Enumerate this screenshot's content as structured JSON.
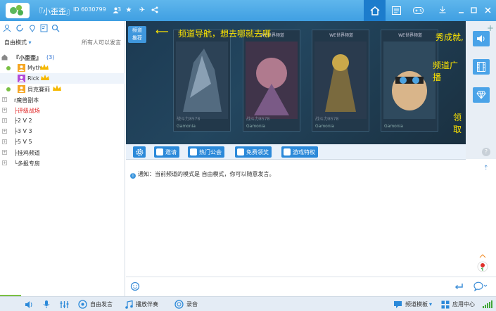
{
  "titlebar": {
    "channel_name": "『小歪歪』",
    "channel_id": "ID 6030799",
    "member_count": "3",
    "accent": "#1c7ccc"
  },
  "left": {
    "mode": "自由模式",
    "mode_note": "所有人可以发言",
    "tree": [
      {
        "label": "『小歪歪』",
        "count": "(3)",
        "type": "root"
      },
      {
        "label": "Myth",
        "type": "user"
      },
      {
        "label": "Rick",
        "type": "user"
      },
      {
        "label": "貝克賽莉",
        "type": "user"
      },
      {
        "label": "r魔兽副本",
        "type": "channel"
      },
      {
        "label": "├评级战场",
        "type": "channel",
        "red": true
      },
      {
        "label": "├2 V 2",
        "type": "channel"
      },
      {
        "label": "├3 V 3",
        "type": "channel"
      },
      {
        "label": "├5 V 5",
        "type": "channel"
      },
      {
        "label": "├挂鸡频道",
        "type": "channel"
      },
      {
        "label": "└多报专房",
        "type": "channel"
      }
    ]
  },
  "banner": {
    "tip_badge_line1": "频道",
    "tip_badge_line2": "推荐",
    "tip_text": "频道导航，想去哪就去哪",
    "right_text1": "秀成就,",
    "right_text2": "频道广播",
    "right_text3": "领取",
    "card_captions": [
      "战斗力8578",
      "战斗力8578",
      "战斗力8578"
    ],
    "card_names": [
      "Gamonia",
      "Gamonia",
      "Gamonia",
      "Gamonia"
    ],
    "card_titles": [
      "WE世界频道",
      "WE世界频道",
      "WE世界频道"
    ]
  },
  "video_bar": {
    "buttons": [
      "邀请",
      "热门公会",
      "免费领奖",
      "游戏特权"
    ]
  },
  "chat": {
    "notice": "通知：当前频道的模式是 自由模式，你可以随意发言。"
  },
  "bottom": {
    "free_speak": "自由发言",
    "accompany": "播放伴奏",
    "record": "录音",
    "channel_template": "频道模板",
    "app_center": "应用中心"
  },
  "icons": [
    "logo-icon",
    "user-icon",
    "star-icon",
    "plane-icon",
    "share-icon",
    "home-icon",
    "list-icon",
    "gamepad-icon",
    "download-icon",
    "minimize-icon",
    "maximize-icon",
    "close-icon"
  ]
}
